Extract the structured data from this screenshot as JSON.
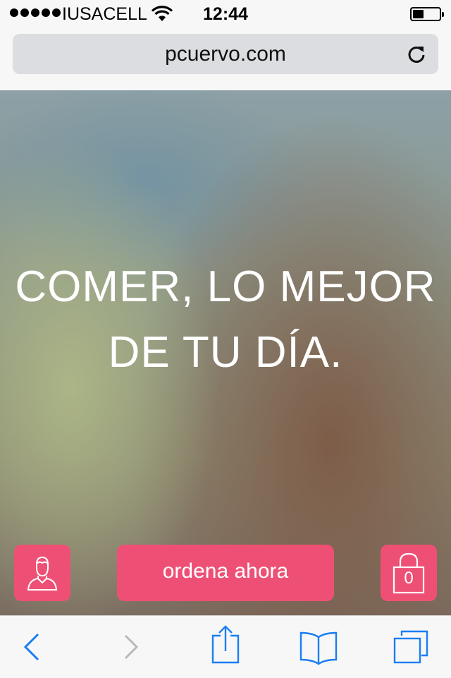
{
  "status_bar": {
    "carrier": "IUSACELL",
    "time": "12:44",
    "signal_bars": 5,
    "battery_level_percent": 40
  },
  "browser": {
    "url": "pcuervo.com"
  },
  "hero": {
    "title_line1": "COMER, LO MEJOR",
    "title_line2": "DE TU DÍA."
  },
  "actions": {
    "order_label": "ordena ahora",
    "cart_count": "0"
  },
  "colors": {
    "accent": "#ee5075",
    "ios_blue": "#1a7ef2"
  },
  "icons": {
    "profile": "user-profile-icon",
    "cart": "shopping-bag-lock-icon",
    "back": "chevron-left-icon",
    "forward": "chevron-right-icon",
    "share": "share-icon",
    "bookmarks": "open-book-icon",
    "tabs": "tabs-icon",
    "reload": "reload-icon"
  }
}
